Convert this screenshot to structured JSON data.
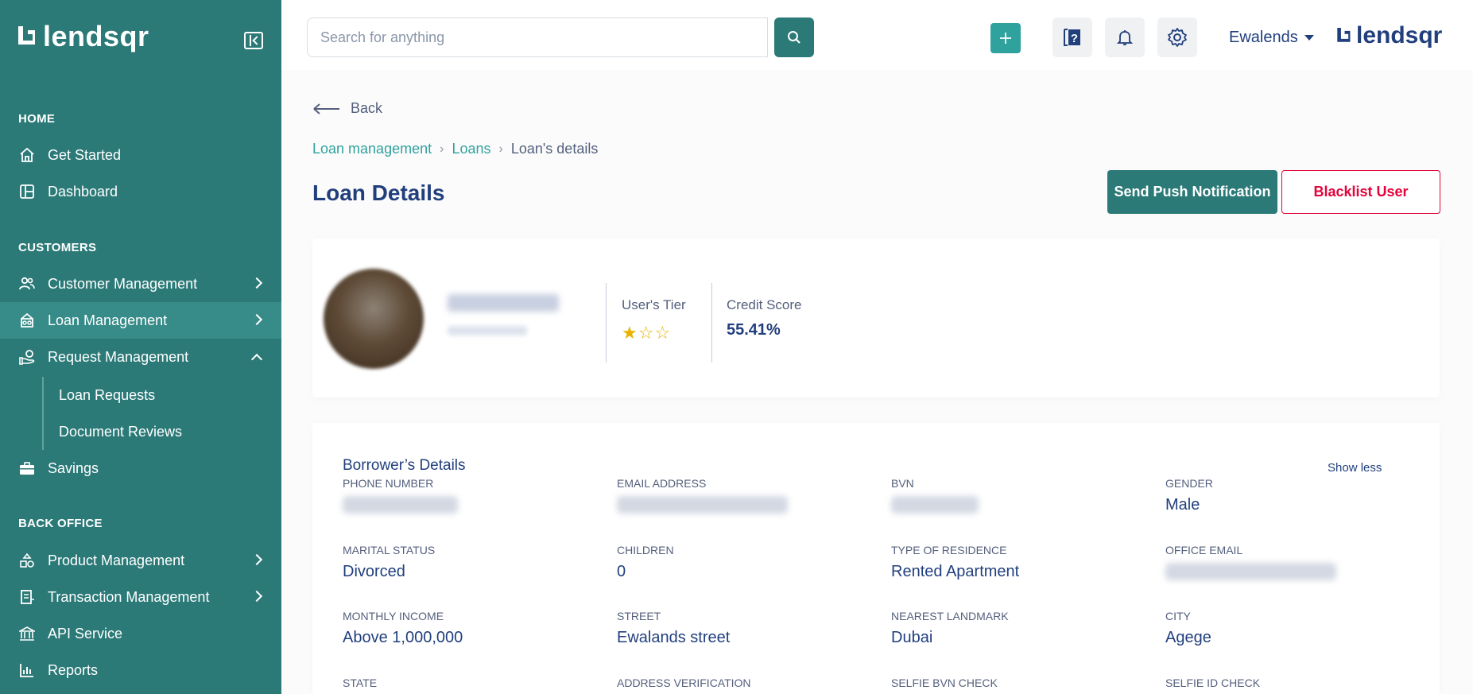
{
  "app": {
    "brand": "lendsqr"
  },
  "sidebar": {
    "sections": {
      "home": "HOME",
      "customers": "CUSTOMERS",
      "back_office": "BACK OFFICE"
    },
    "items": [
      {
        "label": "Get Started"
      },
      {
        "label": "Dashboard"
      },
      {
        "label": "Customer Management"
      },
      {
        "label": "Loan Management"
      },
      {
        "label": "Request Management"
      },
      {
        "label": "Loan Requests"
      },
      {
        "label": "Document Reviews"
      },
      {
        "label": "Savings"
      },
      {
        "label": "Product Management"
      },
      {
        "label": "Transaction Management"
      },
      {
        "label": "API Service"
      },
      {
        "label": "Reports"
      }
    ]
  },
  "topbar": {
    "search_placeholder": "Search for anything",
    "user_name": "Ewalends",
    "brand": "lendsqr"
  },
  "main": {
    "back_label": "Back",
    "breadcrumb": [
      "Loan management",
      "Loans",
      "Loan's details"
    ],
    "title": "Loan Details",
    "push_button": "Send Push Notification",
    "blacklist_button": "Blacklist User"
  },
  "profile": {
    "tier_label": "User's Tier",
    "tier_stars": "★☆☆",
    "tier_value": 1,
    "tier_max": 3,
    "score_label": "Credit Score",
    "score_value": "55.41%"
  },
  "borrower": {
    "heading": "Borrower’s Details",
    "show_less": "Show less",
    "fields": [
      {
        "label": "PHONE NUMBER",
        "value": ""
      },
      {
        "label": "EMAIL ADDRESS",
        "value": ""
      },
      {
        "label": "BVN",
        "value": ""
      },
      {
        "label": "GENDER",
        "value": "Male"
      },
      {
        "label": "MARITAL STATUS",
        "value": "Divorced"
      },
      {
        "label": "CHILDREN",
        "value": "0"
      },
      {
        "label": "TYPE OF RESIDENCE",
        "value": "Rented Apartment"
      },
      {
        "label": "OFFICE EMAIL",
        "value": ""
      },
      {
        "label": "MONTHLY INCOME",
        "value": "Above 1,000,000"
      },
      {
        "label": "STREET",
        "value": "Ewalands street"
      },
      {
        "label": "NEAREST LANDMARK",
        "value": "Dubai"
      },
      {
        "label": "CITY",
        "value": "Agege"
      },
      {
        "label": "STATE",
        "value": ""
      },
      {
        "label": "ADDRESS VERIFICATION",
        "value": ""
      },
      {
        "label": "SELFIE BVN CHECK",
        "value": ""
      },
      {
        "label": "SELFIE ID CHECK",
        "value": ""
      }
    ]
  },
  "colors": {
    "sidebar": "#2b7a78",
    "accent": "#2fa29e",
    "danger": "#e4033b",
    "navy": "#213f7d"
  }
}
